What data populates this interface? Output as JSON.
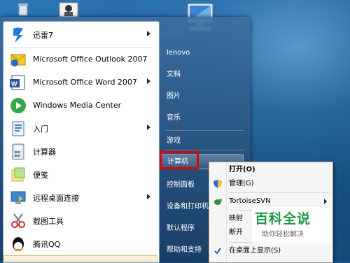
{
  "start_menu": {
    "programs": [
      {
        "label": "迅雷7",
        "icon": "thunder-icon",
        "submenu": true
      },
      {
        "label": "Microsoft Office Outlook 2007",
        "icon": "outlook-icon",
        "submenu": false
      },
      {
        "label": "Microsoft Office Word 2007",
        "icon": "word-icon",
        "submenu": true
      },
      {
        "label": "Windows Media Center",
        "icon": "media-center-icon",
        "submenu": false
      },
      {
        "label": "入门",
        "icon": "getting-started-icon",
        "submenu": true
      },
      {
        "label": "计算器",
        "icon": "calculator-icon",
        "submenu": false
      },
      {
        "label": "便笺",
        "icon": "sticky-notes-icon",
        "submenu": false
      },
      {
        "label": "远程桌面连接",
        "icon": "remote-desktop-icon",
        "submenu": true
      },
      {
        "label": "截图工具",
        "icon": "snipping-tool-icon",
        "submenu": false
      },
      {
        "label": "腾讯QQ",
        "icon": "qq-icon",
        "submenu": false
      }
    ],
    "right_items": [
      "lenovo",
      "文档",
      "图片",
      "音乐",
      "游戏",
      "计算机",
      "控制面板",
      "设备和打印机",
      "默认程序",
      "帮助和支持"
    ]
  },
  "context_menu": {
    "items": [
      {
        "label": "打开(O)",
        "bold": true
      },
      {
        "label": "管理(G)"
      },
      {
        "label": "TortoiseSVN",
        "submenu": true
      },
      {
        "label": "映射"
      },
      {
        "label": "断开"
      },
      {
        "label": "在桌面上显示(S)",
        "checked": true
      }
    ]
  },
  "watermark": {
    "title": "百科全说",
    "subtitle": "助你轻松解决"
  },
  "colors": {
    "highlight_border": "#e40000",
    "accent": "#1c9a48"
  }
}
